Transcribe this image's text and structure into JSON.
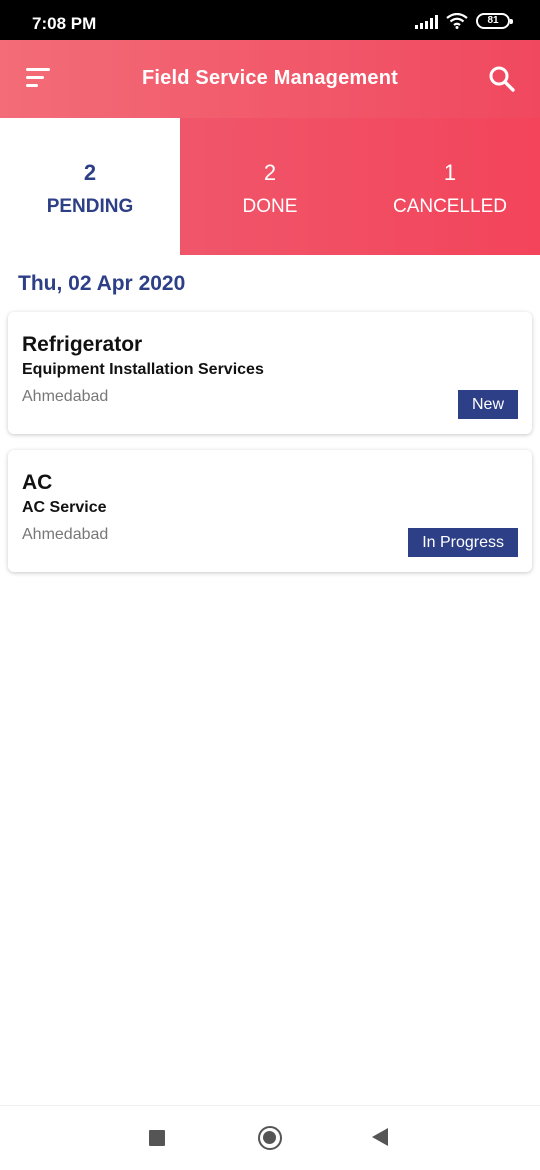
{
  "status_bar": {
    "time": "7:08 PM",
    "battery": "81"
  },
  "app_bar": {
    "title": "Field Service Management",
    "menu_icon": "menu-icon",
    "search_icon": "search-icon"
  },
  "tabs": [
    {
      "count": "2",
      "label": "PENDING",
      "active": true
    },
    {
      "count": "2",
      "label": "DONE",
      "active": false
    },
    {
      "count": "1",
      "label": "CANCELLED",
      "active": false
    }
  ],
  "date_heading": "Thu, 02 Apr 2020",
  "jobs": [
    {
      "title": "Refrigerator",
      "service": "Equipment Installation Services",
      "location": "Ahmedabad",
      "status": "New"
    },
    {
      "title": "AC",
      "service": "AC Service",
      "location": "Ahmedabad",
      "status": "In Progress"
    }
  ],
  "colors": {
    "brand_red": "#f0485f",
    "brand_navy": "#2d3f86"
  },
  "nav_bar": {
    "recent_icon": "square-icon",
    "home_icon": "circle-icon",
    "back_icon": "triangle-back-icon"
  }
}
